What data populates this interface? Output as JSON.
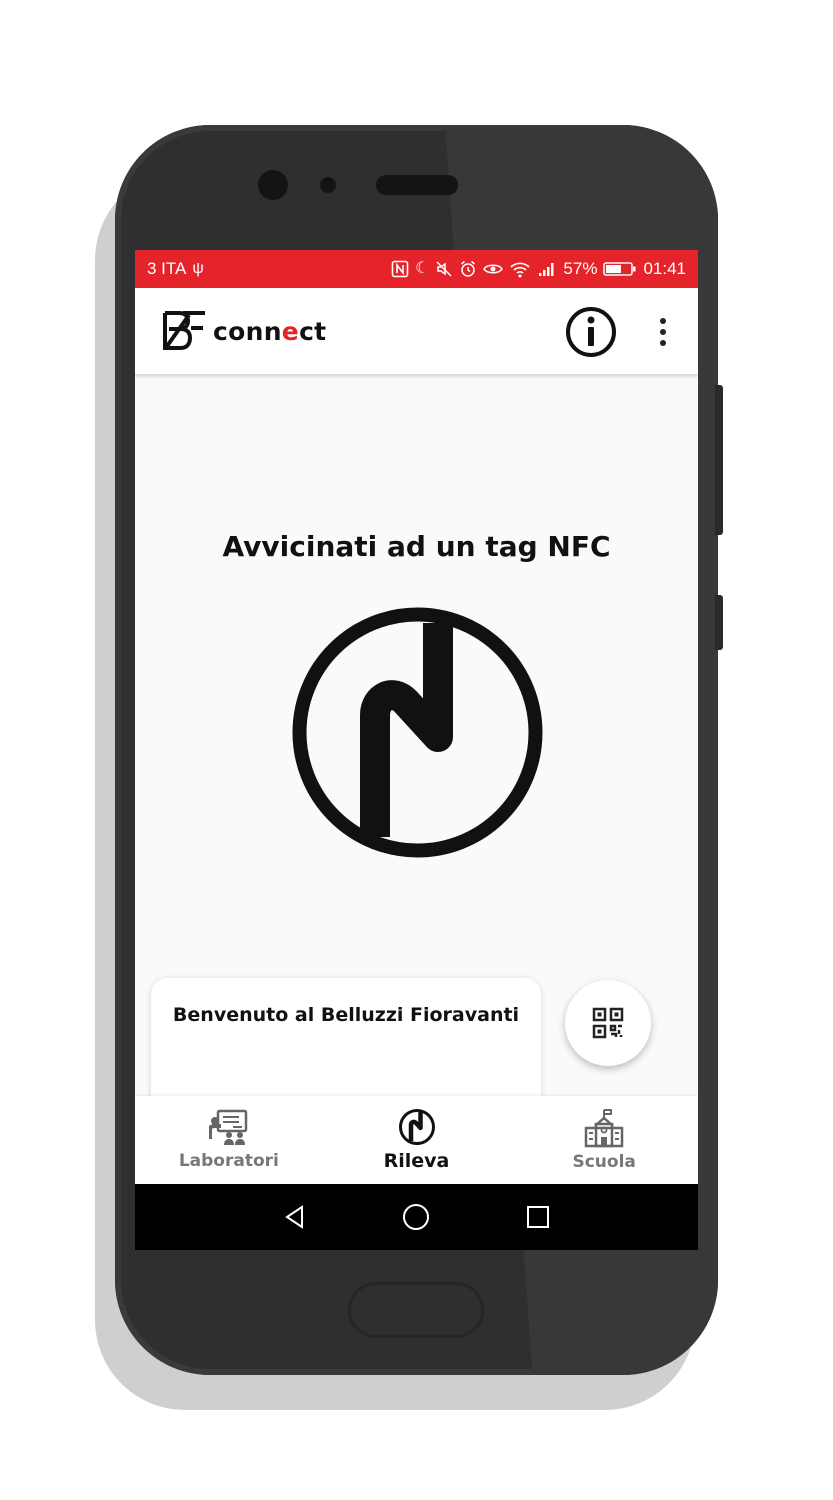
{
  "statusbar": {
    "carrier": "3 ITA",
    "battery": "57%",
    "time": "01:41",
    "color": "#e5232a"
  },
  "appbar": {
    "logo_mark": "BF",
    "logo_text_part1": "conn",
    "logo_text_accent": "e",
    "logo_text_part2": "ct"
  },
  "main": {
    "prompt": "Avvicinati ad un tag NFC"
  },
  "welcome_card": {
    "text": "Benvenuto al Belluzzi Fioravanti"
  },
  "bottom_nav": {
    "items": [
      {
        "label": "Laboratori",
        "icon": "classroom-icon",
        "active": false
      },
      {
        "label": "Rileva",
        "icon": "nfc-icon",
        "active": true
      },
      {
        "label": "Scuola",
        "icon": "school-icon",
        "active": false
      }
    ]
  },
  "system_nav": {
    "back": "back-icon",
    "home": "home-icon",
    "recents": "recents-icon"
  }
}
